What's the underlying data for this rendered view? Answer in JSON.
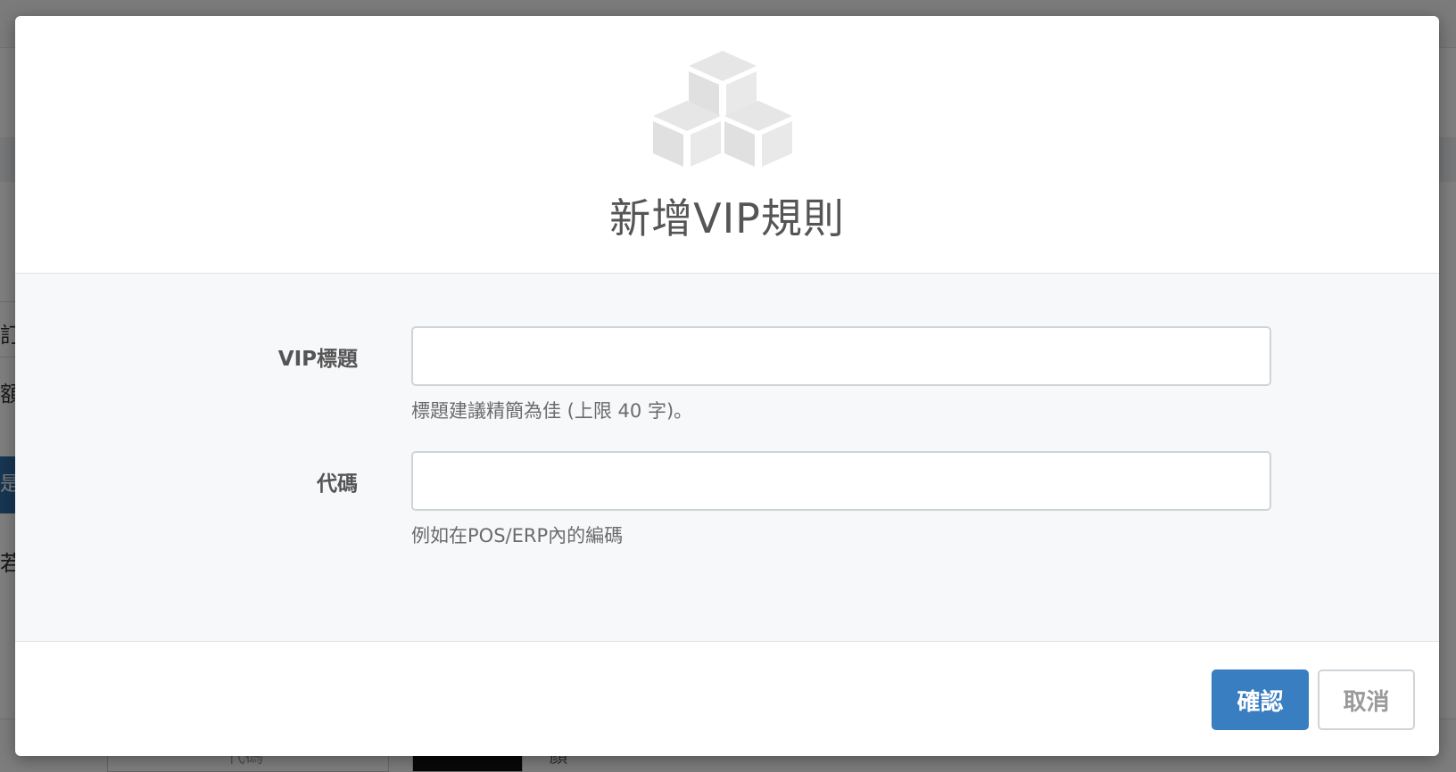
{
  "background": {
    "fragments": [
      "訂",
      "額",
      "是",
      "若",
      "代碼",
      "顏"
    ]
  },
  "modal": {
    "icon": "cubes-icon",
    "title": "新增VIP規則",
    "fields": [
      {
        "label": "VIP標題",
        "value": "",
        "help": "標題建議精簡為佳 (上限 40 字)。"
      },
      {
        "label": "代碼",
        "value": "",
        "help": "例如在POS/ERP內的編碼"
      }
    ],
    "buttons": {
      "confirm": "確認",
      "cancel": "取消"
    }
  },
  "colors": {
    "primary": "#3a7ec2",
    "overlay": "rgba(0,0,0,0.5)",
    "icon": "#e5e5e5"
  }
}
